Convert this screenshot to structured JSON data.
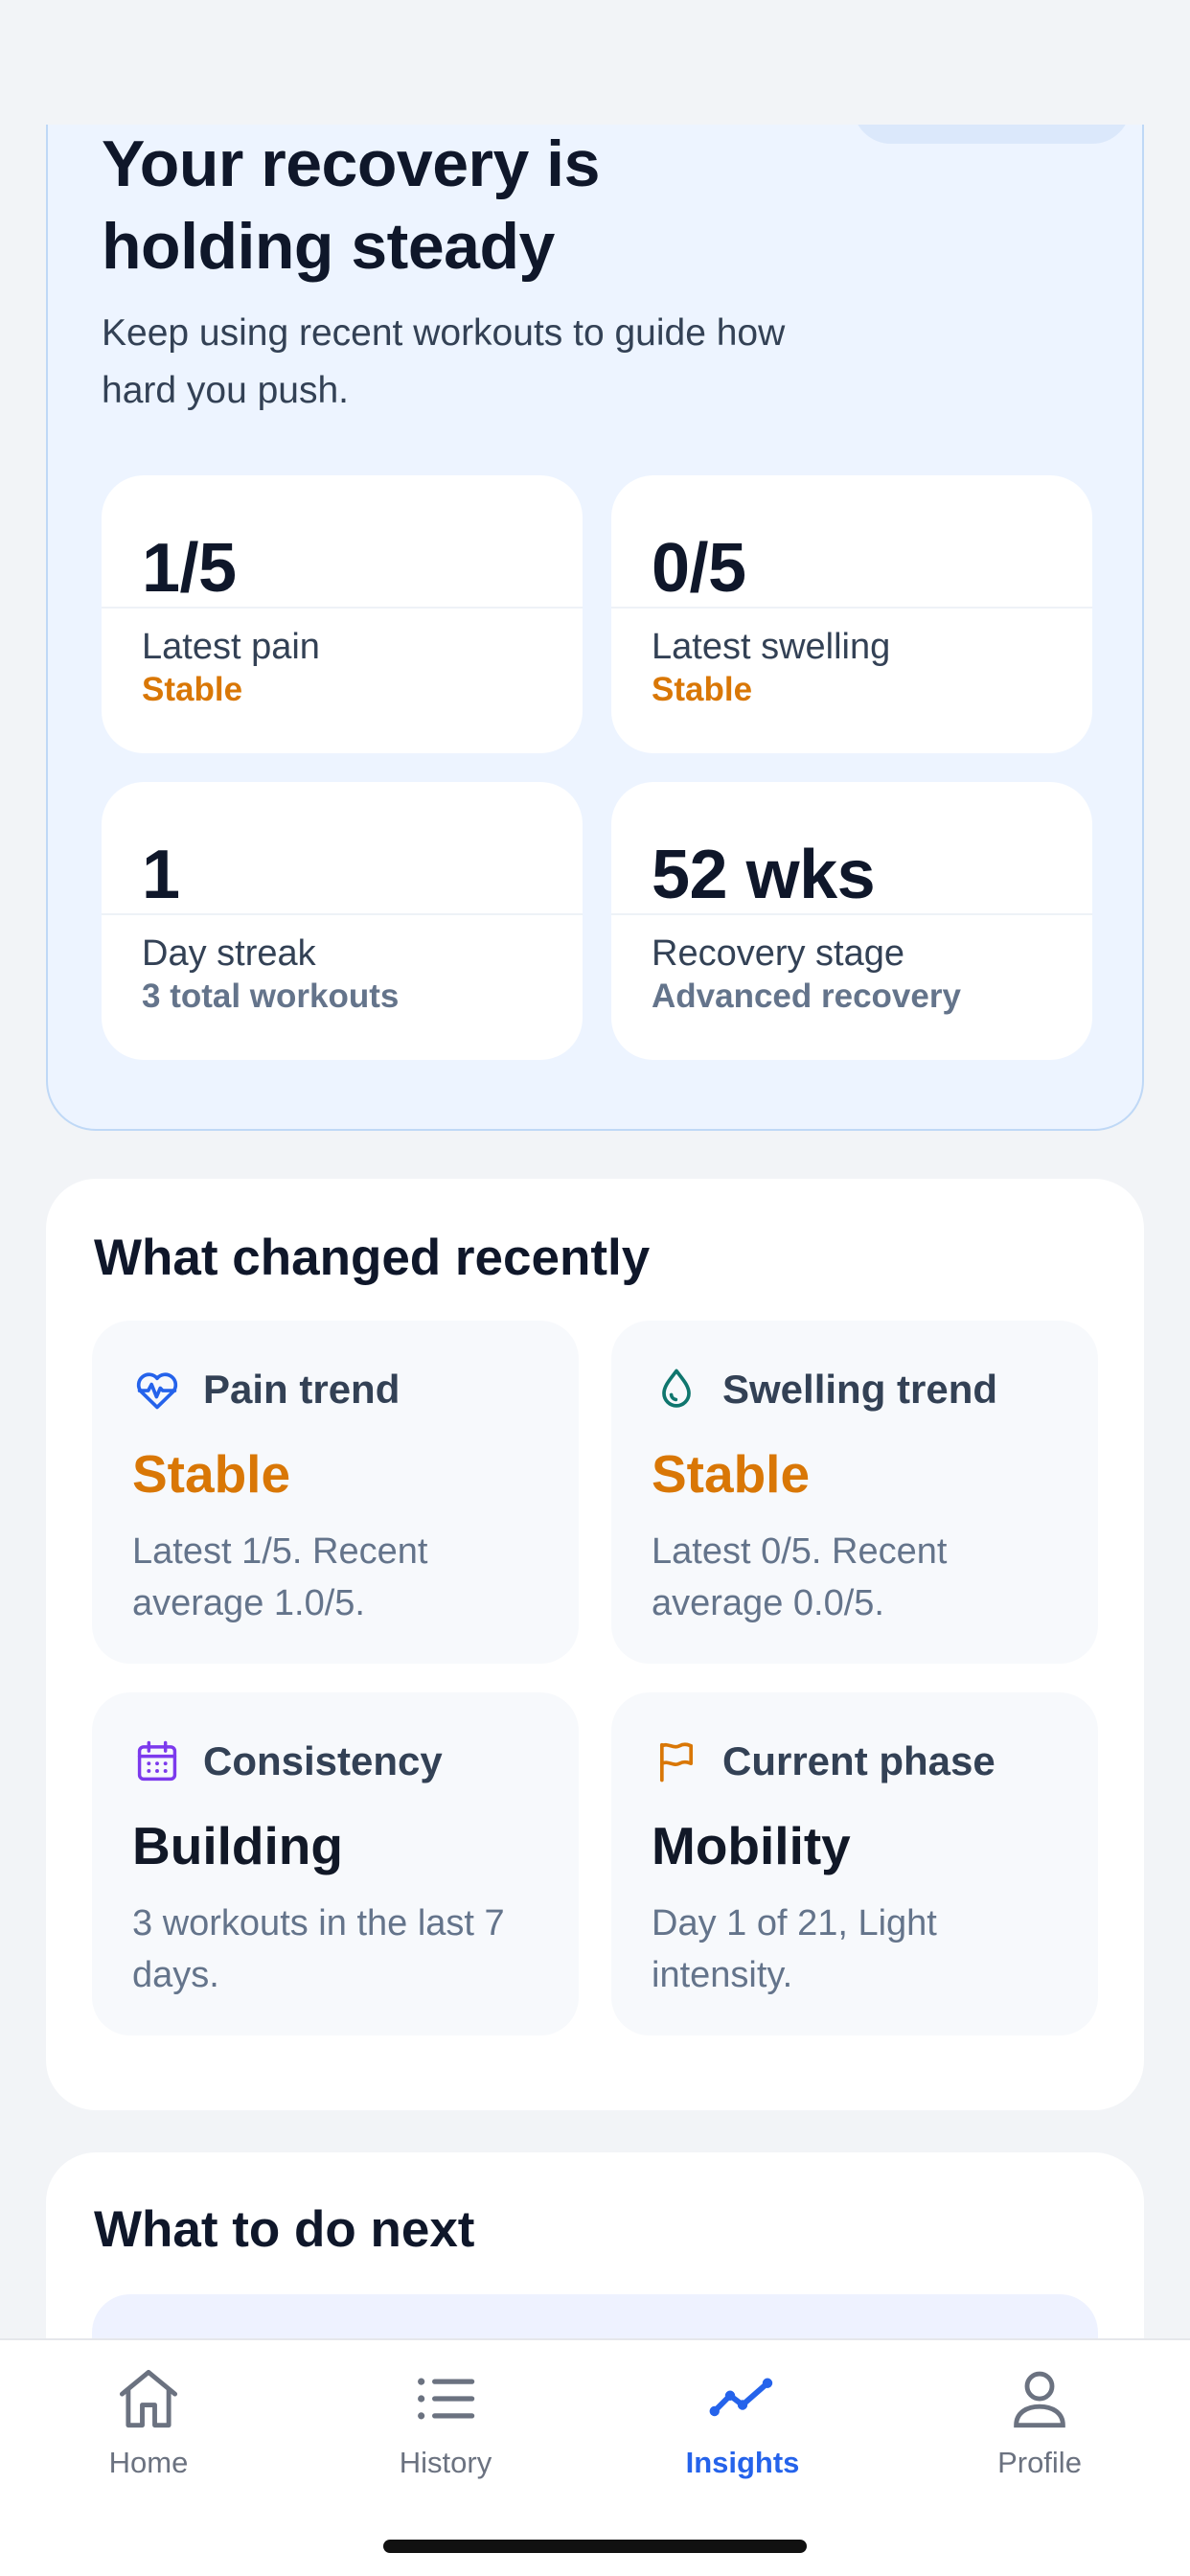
{
  "summary": {
    "title": "Your recovery is holding steady",
    "subtitle": "Keep using recent workouts to guide how hard you push.",
    "stats": [
      {
        "value": "1/5",
        "label": "Latest pain",
        "detail": "Stable"
      },
      {
        "value": "0/5",
        "label": "Latest swelling",
        "detail": "Stable"
      },
      {
        "value": "1",
        "label": "Day streak",
        "detail": "3 total workouts"
      },
      {
        "value": "52 wks",
        "label": "Recovery stage",
        "detail": "Advanced recovery"
      }
    ]
  },
  "changed": {
    "title": "What changed recently",
    "items": [
      {
        "icon": "heart-pulse-icon",
        "name": "Pain trend",
        "status": "Stable",
        "text": "Latest 1/5. Recent average 1.0/5."
      },
      {
        "icon": "droplet-icon",
        "name": "Swelling trend",
        "status": "Stable",
        "text": "Latest 0/5. Recent average 0.0/5."
      },
      {
        "icon": "calendar-icon",
        "name": "Consistency",
        "status": "Building",
        "text": "3 workouts in the last 7 days."
      },
      {
        "icon": "flag-icon",
        "name": "Current phase",
        "status": "Mobility",
        "text": "Day 1 of 21, Light intensity."
      }
    ]
  },
  "next": {
    "title": "What to do next"
  },
  "tabs": [
    {
      "label": "Home",
      "icon": "home-icon"
    },
    {
      "label": "History",
      "icon": "list-icon"
    },
    {
      "label": "Insights",
      "icon": "trend-line-icon",
      "active": true
    },
    {
      "label": "Profile",
      "icon": "person-icon"
    }
  ],
  "colors": {
    "accent": "#2563eb",
    "stable": "#d97706",
    "heart_icon": "#2563eb",
    "droplet_icon": "#0f766e",
    "calendar_icon": "#7c3aed",
    "flag_icon": "#d97706"
  }
}
